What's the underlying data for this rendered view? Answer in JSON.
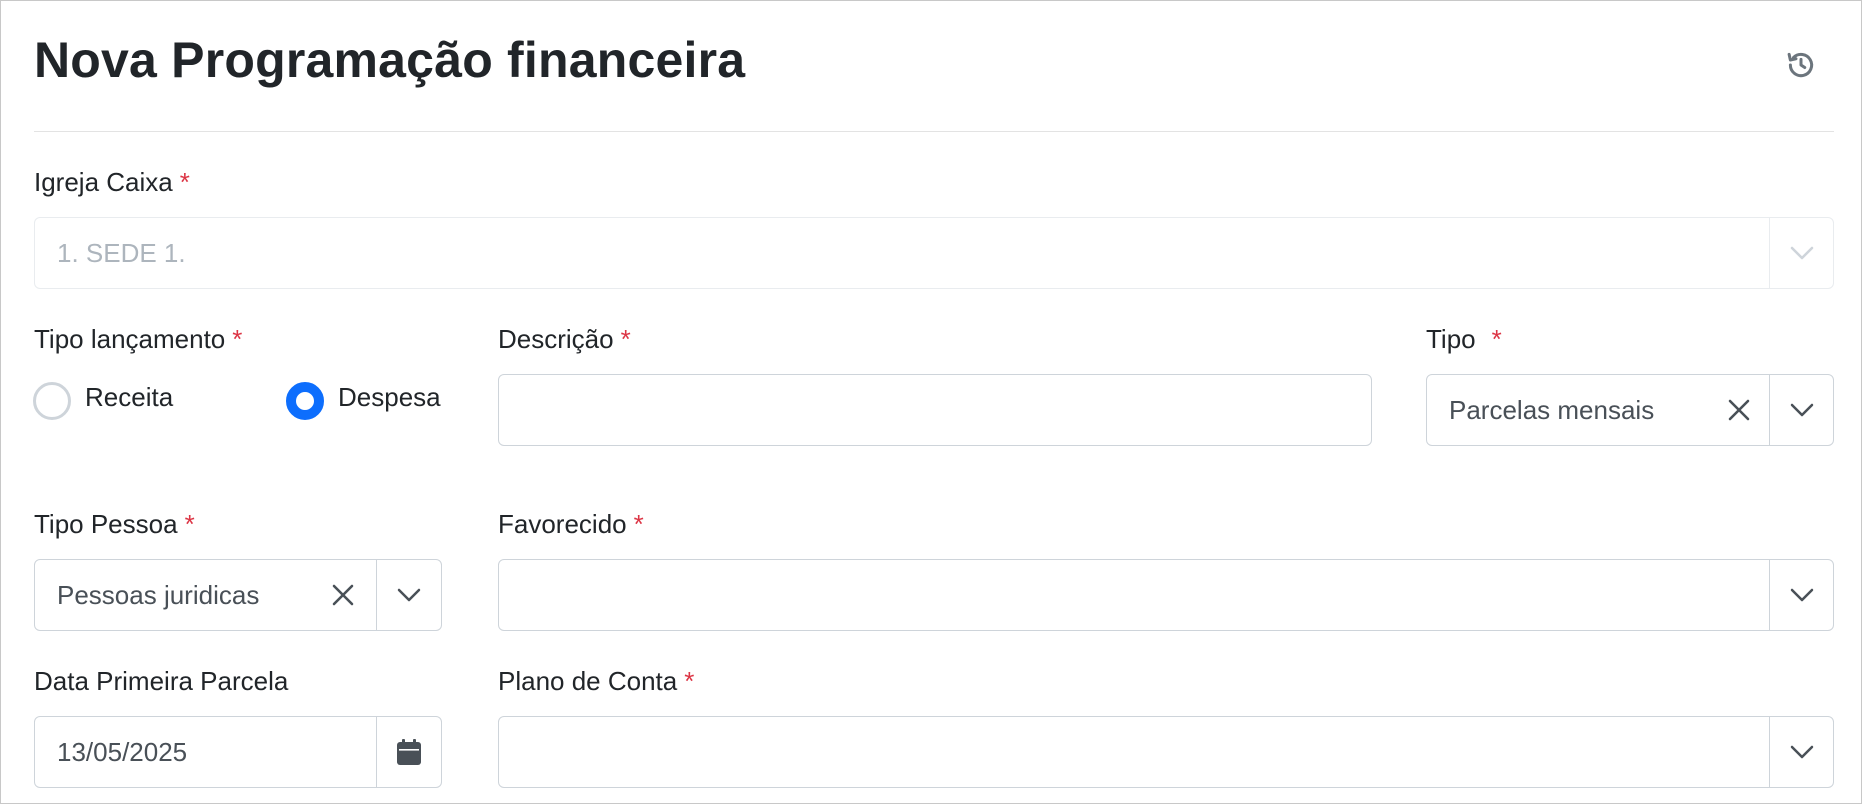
{
  "page": {
    "title": "Nova Programação financeira"
  },
  "icons": {
    "history": "history-icon",
    "clear": "close-icon",
    "dropdown": "chevron-down-icon",
    "calendar": "calendar-icon"
  },
  "colors": {
    "primary": "#0d6efd",
    "required": "#dc3545",
    "border": "#ced4da"
  },
  "form": {
    "igreja_caixa": {
      "label": "Igreja Caixa",
      "required_mark": "*",
      "value": "1. SEDE 1."
    },
    "tipo_lancamento": {
      "label": "Tipo lançamento",
      "required_mark": "*",
      "options": [
        {
          "label": "Receita",
          "selected": false
        },
        {
          "label": "Despesa",
          "selected": true
        }
      ]
    },
    "descricao": {
      "label": "Descrição",
      "required_mark": "*",
      "value": ""
    },
    "tipo": {
      "label": "Tipo",
      "required_mark": "*",
      "value": "Parcelas mensais"
    },
    "tipo_pessoa": {
      "label": "Tipo Pessoa",
      "required_mark": "*",
      "value": "Pessoas juridicas"
    },
    "favorecido": {
      "label": "Favorecido",
      "required_mark": "*",
      "value": ""
    },
    "data_primeira_parcela": {
      "label": "Data Primeira Parcela",
      "value": "13/05/2025"
    },
    "plano_de_conta": {
      "label": "Plano de Conta",
      "required_mark": "*",
      "value": ""
    }
  }
}
